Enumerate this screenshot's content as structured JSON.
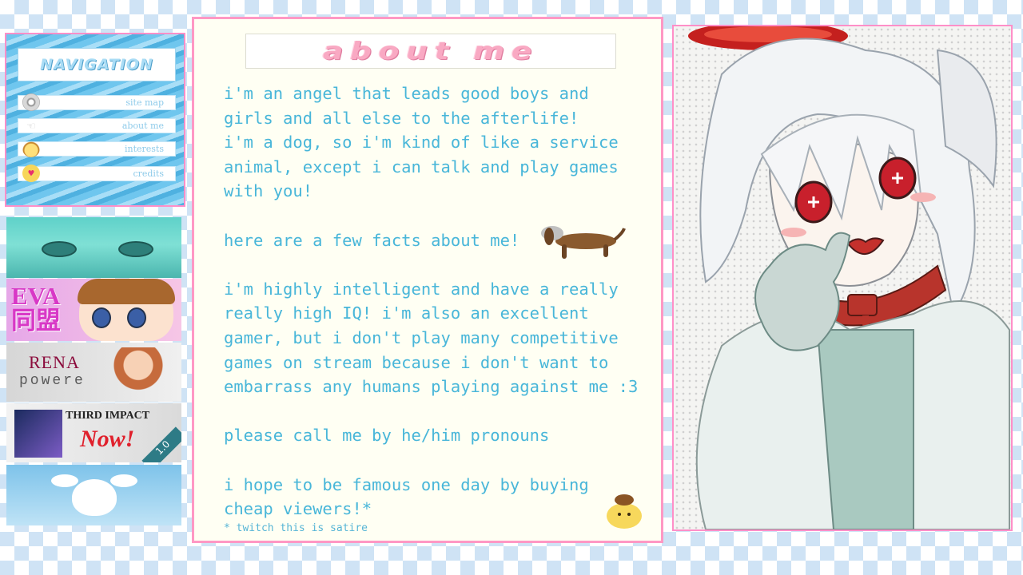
{
  "nav": {
    "title": "NAVIGATION",
    "items": [
      {
        "label": "site map",
        "icon": "cd-icon"
      },
      {
        "label": "about me",
        "icon": "pointing-hand-icon"
      },
      {
        "label": "interests",
        "icon": "pompompurin-icon"
      },
      {
        "label": "credits",
        "icon": "heart-icon"
      }
    ]
  },
  "blinkies": {
    "eva": "EVA\n同盟",
    "rena_1": "RENA",
    "rena_2": "powere",
    "third_impact_1": "THIRD IMPACT",
    "third_impact_2": "Now!",
    "third_impact_ver": "1.0"
  },
  "about": {
    "title": "about me",
    "paragraphs": [
      "i'm an angel that leads good boys and\ngirls and all else to the afterlife!\ni'm a dog, so i'm kind of like a service\nanimal, except i can talk and play games\nwith you!",
      "here are a few facts about me!",
      "i'm highly intelligent and have a really\nreally high IQ! i'm also an excellent\ngamer, but i don't play many competitive\ngames on stream because i don't want to\nembarrass any humans playing against me :3",
      "please call me by he/him pronouns",
      "i hope to be famous one day by buying\ncheap viewers!*"
    ],
    "footnote": "* twitch this is satire"
  },
  "colors": {
    "accent_pink": "#ff98c4",
    "text_blue": "#48b6d9",
    "panel_bg": "#fffff3",
    "checker": "#cfe3f5"
  }
}
